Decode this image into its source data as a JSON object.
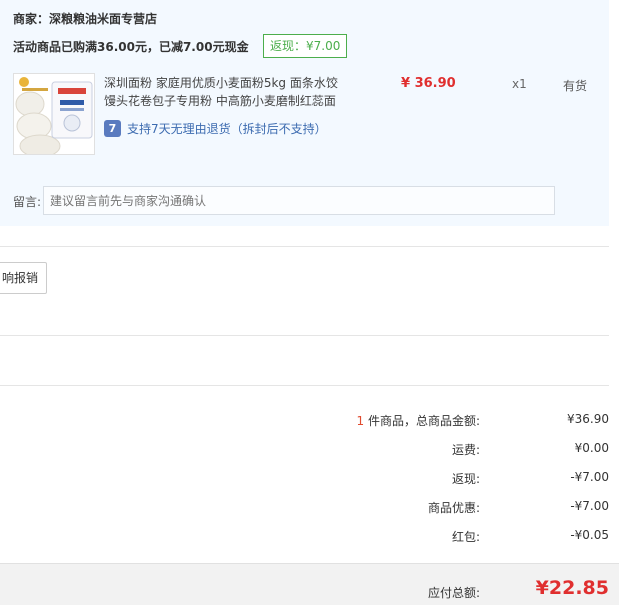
{
  "merchant": {
    "label": "商家：",
    "name": "深粮粮油米面专营店"
  },
  "promotion": {
    "text": "活动商品已购满36.00元，已减7.00元现金",
    "cashback_badge": "返现：¥7.00"
  },
  "product": {
    "title": "深圳面粉 家庭用优质小麦面粉5kg 面条水饺馒头花卷包子专用粉 中高筋小麦磨制红蕊面",
    "return_icon": "7",
    "return_policy": "支持7天无理由退货（拆封后不支持）",
    "price": "¥ 36.90",
    "quantity": "x1",
    "stock": "有货"
  },
  "note": {
    "label": "留言:",
    "placeholder": "建议留言前先与商家沟通确认"
  },
  "invoice": {
    "button_label": "响报销"
  },
  "summary": {
    "items_count": "1",
    "items_label": " 件商品，总商品金额:",
    "items_total": "¥36.90",
    "shipping_label": "运费:",
    "shipping_value": "¥0.00",
    "cashback_label": "返现:",
    "cashback_value": "-¥7.00",
    "discount_label": "商品优惠:",
    "discount_value": "-¥7.00",
    "redpacket_label": "红包:",
    "redpacket_value": "-¥0.05"
  },
  "total": {
    "label": "应付总额:",
    "value": "¥22.85"
  }
}
